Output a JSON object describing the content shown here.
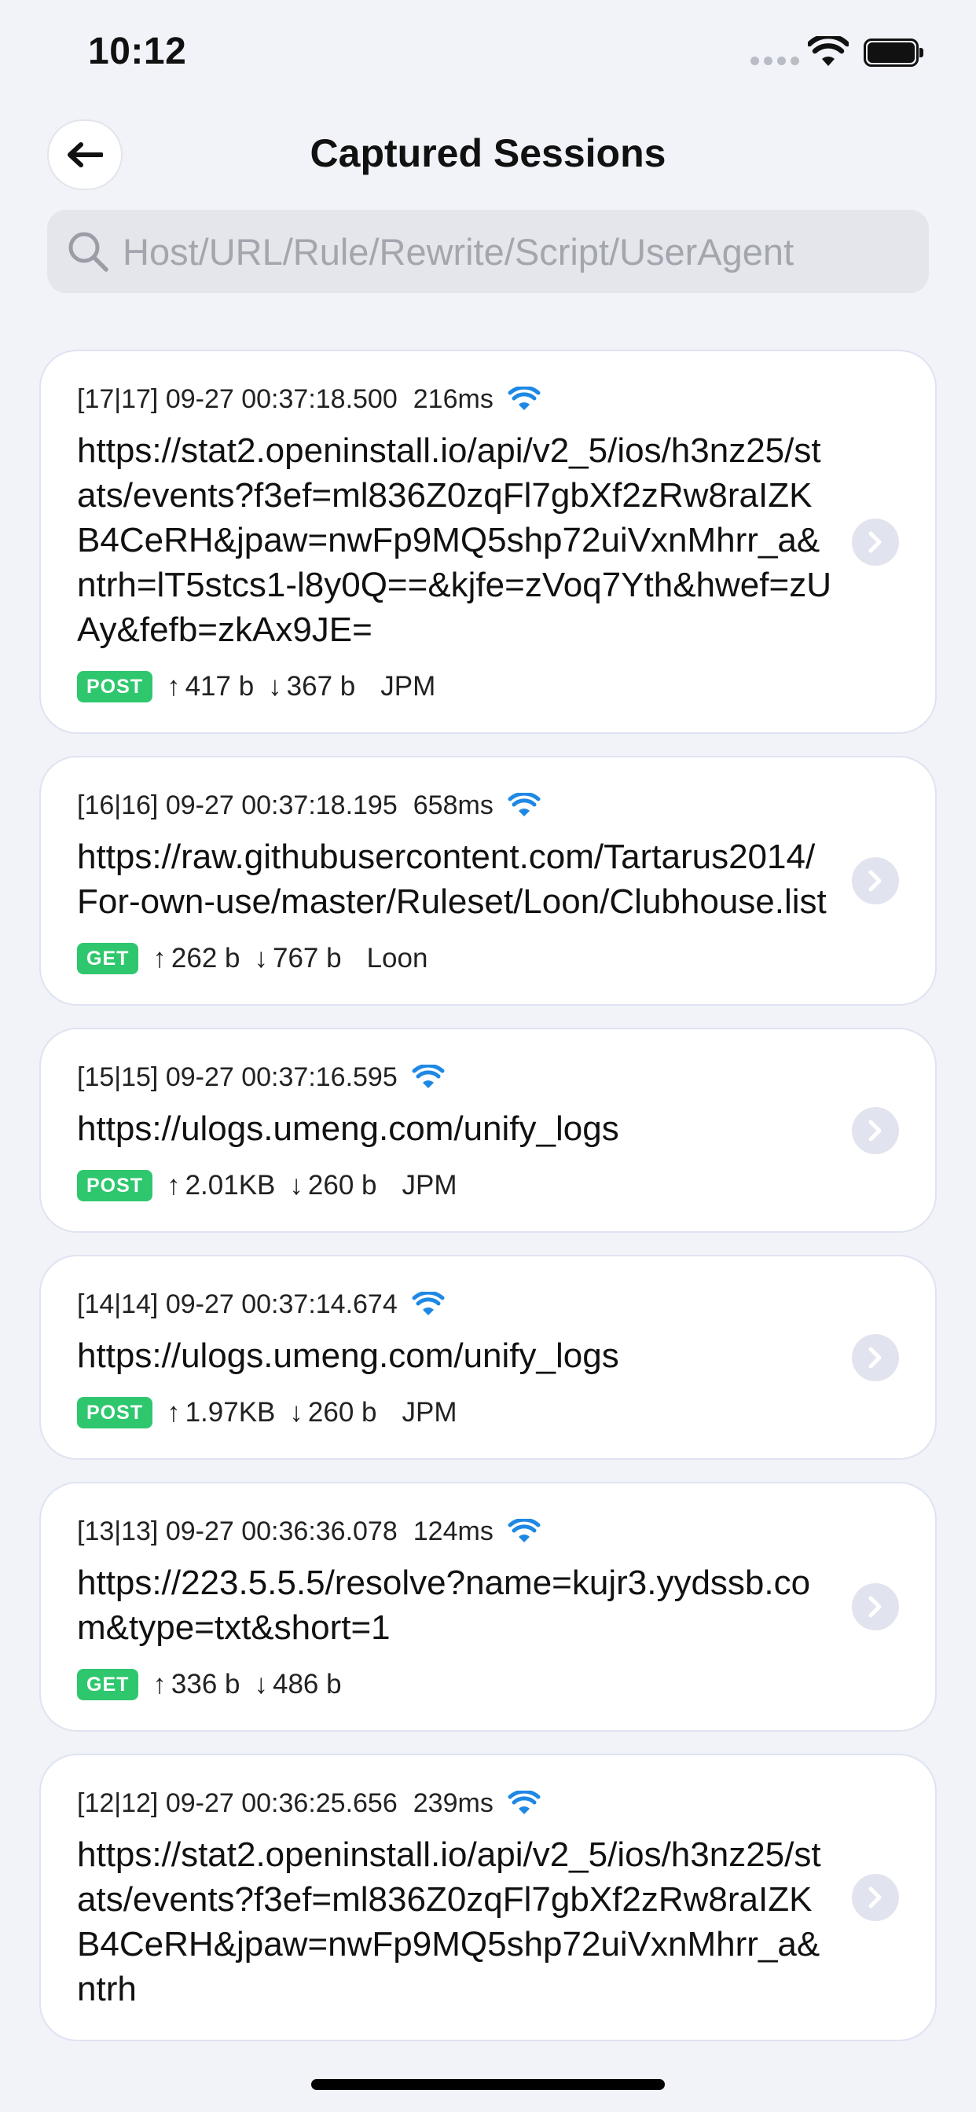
{
  "status_bar": {
    "time": "10:12"
  },
  "header": {
    "title": "Captured Sessions"
  },
  "search": {
    "placeholder": "Host/URL/Rule/Rewrite/Script/UserAgent"
  },
  "colors": {
    "accent": "#2fc76e",
    "wifi": "#1e88e5",
    "background": "#f1f3f8"
  },
  "sessions": [
    {
      "id": "[17|17]",
      "time": "09-27 00:37:18.500",
      "duration": "216ms",
      "url": "https://stat2.openinstall.io/api/v2_5/ios/h3nz25/stats/events?f3ef=ml836Z0zqFl7gbXf2zRw8raIZKB4CeRH&jpaw=nwFp9MQ5shp72uiVxnMhrr_a&ntrh=lT5stcs1-l8y0Q==&kjfe=zVoq7Yth&hwef=zUAy&fefb=zkAx9JE=",
      "method": "POST",
      "up": "417 b",
      "down": "367 b",
      "policy": "JPM"
    },
    {
      "id": "[16|16]",
      "time": "09-27 00:37:18.195",
      "duration": "658ms",
      "url": "https://raw.githubusercontent.com/Tartarus2014/For-own-use/master/Ruleset/Loon/Clubhouse.list",
      "method": "GET",
      "up": "262 b",
      "down": "767 b",
      "policy": "Loon"
    },
    {
      "id": "[15|15]",
      "time": "09-27 00:37:16.595",
      "duration": "",
      "url": "https://ulogs.umeng.com/unify_logs",
      "method": "POST",
      "up": "2.01KB",
      "down": "260 b",
      "policy": "JPM"
    },
    {
      "id": "[14|14]",
      "time": "09-27 00:37:14.674",
      "duration": "",
      "url": "https://ulogs.umeng.com/unify_logs",
      "method": "POST",
      "up": "1.97KB",
      "down": "260 b",
      "policy": "JPM"
    },
    {
      "id": "[13|13]",
      "time": "09-27 00:36:36.078",
      "duration": "124ms",
      "url": "https://223.5.5.5/resolve?name=kujr3.yydssb.com&type=txt&short=1",
      "method": "GET",
      "up": "336 b",
      "down": "486 b",
      "policy": ""
    },
    {
      "id": "[12|12]",
      "time": "09-27 00:36:25.656",
      "duration": "239ms",
      "url": "https://stat2.openinstall.io/api/v2_5/ios/h3nz25/stats/events?f3ef=ml836Z0zqFl7gbXf2zRw8raIZKB4CeRH&jpaw=nwFp9MQ5shp72uiVxnMhrr_a&ntrh",
      "method": "",
      "up": "",
      "down": "",
      "policy": ""
    }
  ]
}
